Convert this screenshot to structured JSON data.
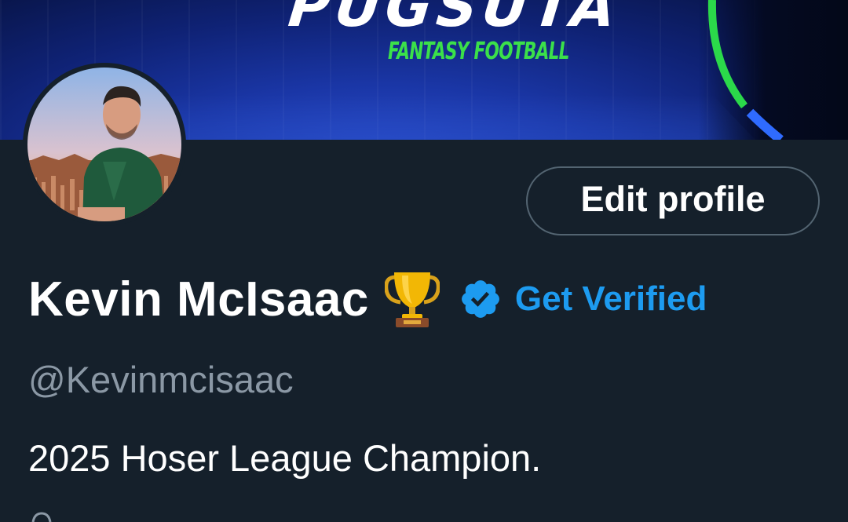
{
  "banner": {
    "brand_title": "PUGSUTA",
    "brand_subtitle": "FANTASY FOOTBALL",
    "arc_colors": [
      "#2bd94a",
      "#2f6bff"
    ]
  },
  "profile": {
    "display_name": "Kevin McIsaac",
    "name_emoji": "trophy-icon",
    "verified_badge": "verified-badge-icon",
    "get_verified_label": "Get Verified",
    "handle": "@Kevinmcisaac",
    "bio": "2025 Hoser League Champion."
  },
  "actions": {
    "edit_profile_label": "Edit profile"
  },
  "colors": {
    "background": "#15202b",
    "accent": "#1d9bf0",
    "muted_text": "#8b98a5",
    "button_border": "#536471"
  }
}
